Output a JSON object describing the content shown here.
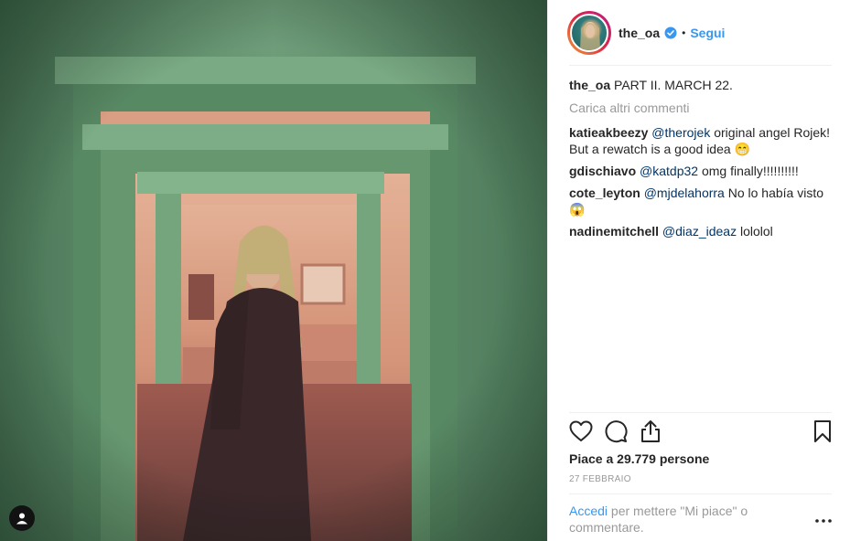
{
  "post": {
    "username": "the_oa",
    "verified": true,
    "separator": "•",
    "follow_label": "Segui",
    "caption_user": "the_oa",
    "caption_text": " PART II. MARCH 22.",
    "load_more": "Carica altri commenti",
    "comments": [
      {
        "user": "katieakbeezy",
        "mention": "@therojek",
        "text": " original angel Rojek! But a rewatch is a good idea 😁"
      },
      {
        "user": "gdischiavo",
        "mention": "@katdp32",
        "text": " omg finally!!!!!!!!!!"
      },
      {
        "user": "cote_leyton",
        "mention": "@mjdelahorra",
        "text": " No lo había visto 😱"
      },
      {
        "user": "nadinemitchell",
        "mention": "@diaz_ideaz",
        "text": " lololol"
      }
    ],
    "likes": "Piace a 29.779 persone",
    "date": "27 FEBBRAIO",
    "login_link": "Accedi",
    "login_text": " per mettere \"Mi piace\" o commentare."
  },
  "icons": {
    "like": "heart-icon",
    "comment": "comment-icon",
    "share": "share-icon",
    "save": "bookmark-icon",
    "more": "more-options-icon",
    "user_tag": "user-tag-icon",
    "verified": "verified-badge-icon"
  },
  "colors": {
    "link": "#3897f0",
    "mention": "#003569",
    "muted": "#999999",
    "photo_green": "#6f9a78",
    "photo_peach": "#d98671"
  }
}
